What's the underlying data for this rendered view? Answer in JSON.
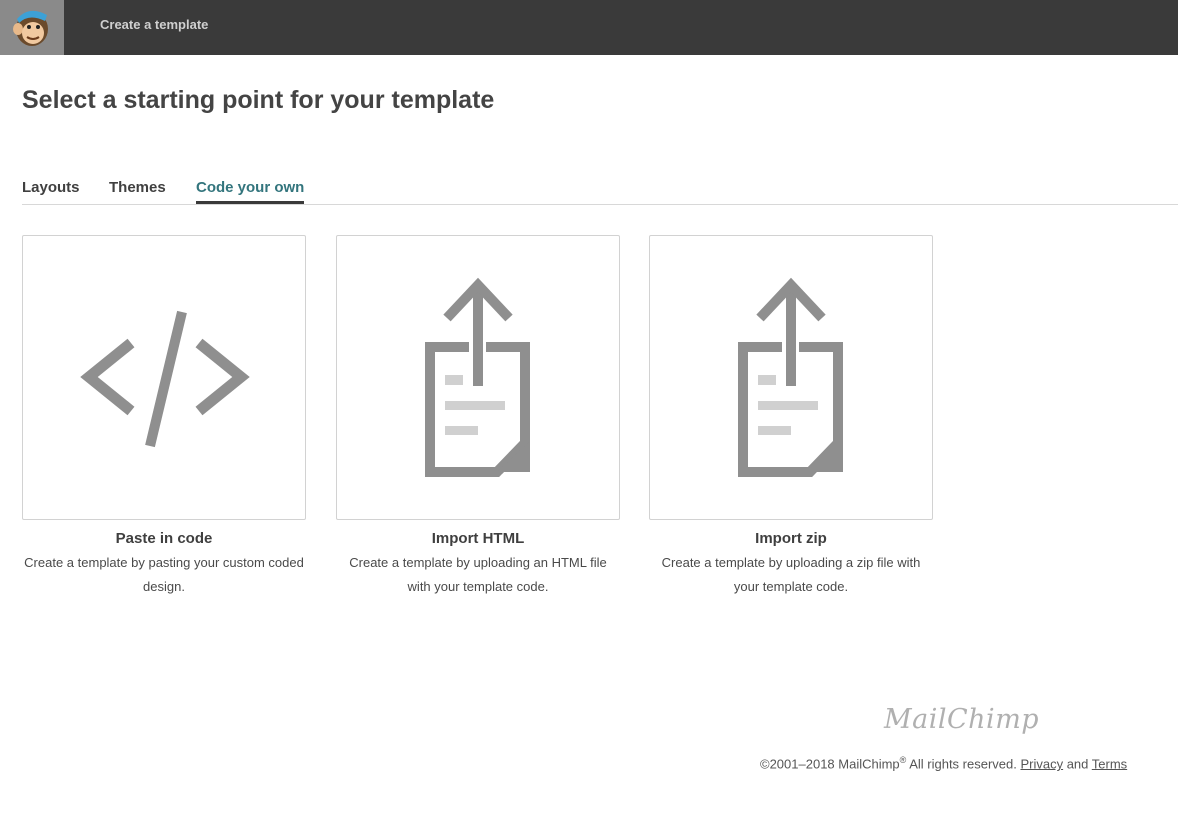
{
  "header": {
    "title": "Create a template"
  },
  "page": {
    "title": "Select a starting point for your template"
  },
  "tabs": [
    {
      "label": "Layouts",
      "active": false
    },
    {
      "label": "Themes",
      "active": false
    },
    {
      "label": "Code your own",
      "active": true
    }
  ],
  "cards": [
    {
      "title": "Paste in code",
      "desc": "Create a template by pasting your custom coded design.",
      "icon": "code-icon"
    },
    {
      "title": "Import HTML",
      "desc": "Create a template by uploading an HTML file with your template code.",
      "icon": "upload-file-icon"
    },
    {
      "title": "Import zip",
      "desc": "Create a template by uploading a zip file with your template code.",
      "icon": "upload-file-icon"
    }
  ],
  "footer": {
    "brand": "MailChimp",
    "copyright": "©2001–2018 MailChimp",
    "registered": "®",
    "rights": " All rights reserved. ",
    "privacy_label": "Privacy",
    "and": " and ",
    "terms_label": "Terms"
  },
  "colors": {
    "topbar": "#3a3a3a",
    "logo_bg": "#8a8a8a",
    "active_tab": "#33757d",
    "icon_gray": "#8f8f8f"
  }
}
